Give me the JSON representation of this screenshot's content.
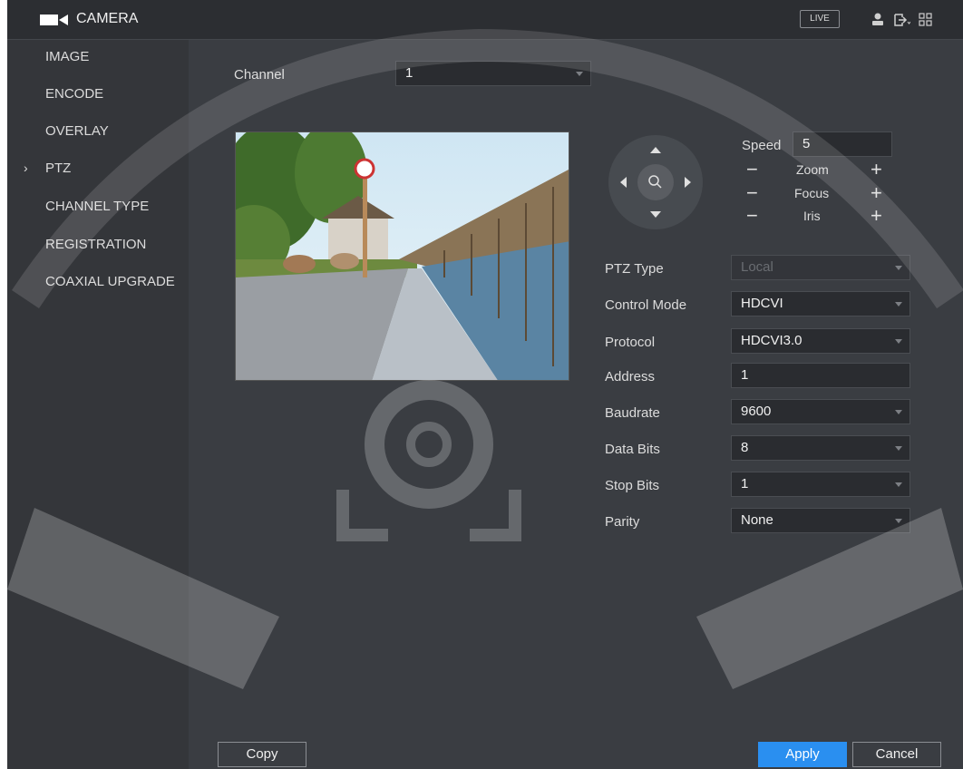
{
  "header": {
    "title": "CAMERA",
    "live_label": "LIVE"
  },
  "sidebar": {
    "items": [
      {
        "label": "IMAGE"
      },
      {
        "label": "ENCODE"
      },
      {
        "label": "OVERLAY"
      },
      {
        "label": "PTZ",
        "active": true
      },
      {
        "label": "CHANNEL TYPE"
      },
      {
        "label": "REGISTRATION"
      },
      {
        "label": "COAXIAL UPGRADE"
      }
    ],
    "active_marker": "›"
  },
  "channel": {
    "label": "Channel",
    "value": "1"
  },
  "ptz_control": {
    "speed_label": "Speed",
    "speed_value": "5",
    "zoom_label": "Zoom",
    "focus_label": "Focus",
    "iris_label": "Iris",
    "minus": "−",
    "plus": "+"
  },
  "settings": {
    "ptz_type": {
      "label": "PTZ Type",
      "value": "Local"
    },
    "control_mode": {
      "label": "Control Mode",
      "value": "HDCVI"
    },
    "protocol": {
      "label": "Protocol",
      "value": "HDCVI3.0"
    },
    "address": {
      "label": "Address",
      "value": "1"
    },
    "baudrate": {
      "label": "Baudrate",
      "value": "9600"
    },
    "data_bits": {
      "label": "Data Bits",
      "value": "8"
    },
    "stop_bits": {
      "label": "Stop Bits",
      "value": "1"
    },
    "parity": {
      "label": "Parity",
      "value": "None"
    }
  },
  "footer": {
    "copy_label": "Copy",
    "apply_label": "Apply",
    "cancel_label": "Cancel"
  },
  "colors": {
    "accent": "#2a8ff0",
    "background": "#3a3d42",
    "sidebar": "#34363a"
  }
}
